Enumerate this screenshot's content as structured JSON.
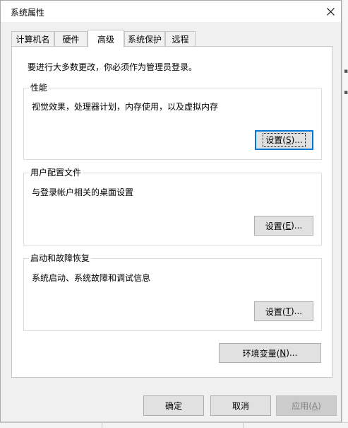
{
  "window": {
    "title": "系统属性"
  },
  "tabs": [
    {
      "label": "计算机名"
    },
    {
      "label": "硬件"
    },
    {
      "label": "高级"
    },
    {
      "label": "系统保护"
    },
    {
      "label": "远程"
    }
  ],
  "admin_note": "要进行大多数更改，你必须作为管理员登录。",
  "groups": {
    "performance": {
      "label": "性能",
      "desc": "视觉效果，处理器计划，内存使用，以及虚拟内存",
      "btn_pre": "设置(",
      "btn_key": "S",
      "btn_post": ")..."
    },
    "profiles": {
      "label": "用户配置文件",
      "desc": "与登录帐户相关的桌面设置",
      "btn_pre": "设置(",
      "btn_key": "E",
      "btn_post": ")..."
    },
    "startup": {
      "label": "启动和故障恢复",
      "desc": "系统启动、系统故障和调试信息",
      "btn_pre": "设置(",
      "btn_key": "T",
      "btn_post": ")..."
    }
  },
  "env_button": {
    "pre": "环境变量(",
    "key": "N",
    "post": ")..."
  },
  "footer": {
    "ok": "确定",
    "cancel": "取消",
    "apply_pre": "应用(",
    "apply_key": "A",
    "apply_post": ")"
  },
  "colors": {
    "focus": "#0078d7",
    "dialog_bg": "#f0f0f0",
    "panel_bg": "#ffffff"
  }
}
